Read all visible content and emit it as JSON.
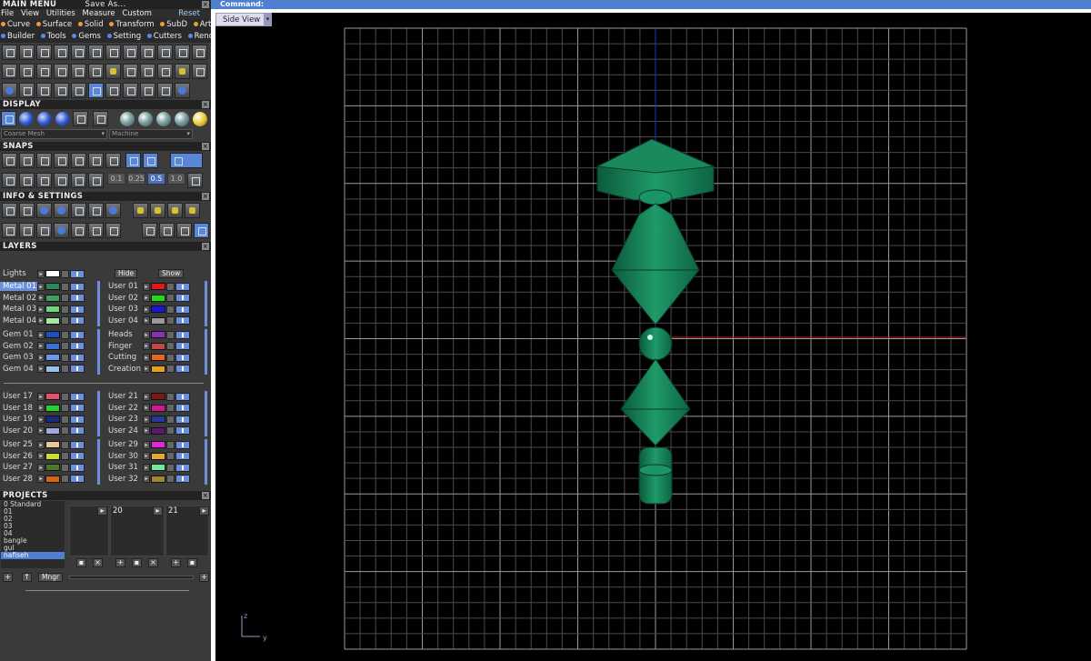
{
  "menu": {
    "title": "MAIN MENU",
    "save_as": "Save As...",
    "items": [
      "File",
      "View",
      "Utilities",
      "Measure",
      "Custom"
    ],
    "reset": "Reset",
    "row1": [
      "Curve",
      "Surface",
      "Solid",
      "Transform",
      "SubD",
      "Art"
    ],
    "row2": [
      "Builder",
      "Tools",
      "Gems",
      "Setting",
      "Cutters",
      "Render"
    ]
  },
  "display": {
    "title": "DISPLAY",
    "mesh_select": "Coarse Mesh",
    "material_select": "Machine"
  },
  "snaps": {
    "title": "SNAPS",
    "values": [
      "0.1",
      "0.25",
      "0.5",
      "1.0"
    ]
  },
  "info": {
    "title": "INFO & SETTINGS"
  },
  "layers": {
    "title": "LAYERS",
    "lights": "Lights",
    "hide": "Hide",
    "show": "Show",
    "groups": [
      {
        "left": [
          {
            "name": "Metal 01",
            "color": "#2a8a55"
          },
          {
            "name": "Metal 02",
            "color": "#3fa060"
          },
          {
            "name": "Metal 03",
            "color": "#6fd878"
          },
          {
            "name": "Metal 04",
            "color": "#a8e8a0"
          }
        ],
        "right": [
          {
            "name": "User 01",
            "color": "#e01818"
          },
          {
            "name": "User 02",
            "color": "#18e018"
          },
          {
            "name": "User 03",
            "color": "#1818d8"
          },
          {
            "name": "User 04",
            "color": "#9a9a9a"
          }
        ]
      },
      {
        "left": [
          {
            "name": "Gem 01",
            "color": "#1a50c0"
          },
          {
            "name": "Gem 02",
            "color": "#3a70d8"
          },
          {
            "name": "Gem 03",
            "color": "#6a98e8"
          },
          {
            "name": "Gem 04",
            "color": "#98c0f0"
          }
        ],
        "right": [
          {
            "name": "Heads",
            "color": "#8a30b8"
          },
          {
            "name": "Finger",
            "color": "#c04848"
          },
          {
            "name": "Cutting",
            "color": "#e06820"
          },
          {
            "name": "Creation",
            "color": "#e8a020"
          }
        ]
      },
      {
        "left": [
          {
            "name": "User 17",
            "color": "#e85070"
          },
          {
            "name": "User 18",
            "color": "#28d028"
          },
          {
            "name": "User 19",
            "color": "#1a2a80"
          },
          {
            "name": "User 20",
            "color": "#a0a8e0"
          }
        ],
        "right": [
          {
            "name": "User 21",
            "color": "#7a1818"
          },
          {
            "name": "User 22",
            "color": "#d01890"
          },
          {
            "name": "User 23",
            "color": "#283898"
          },
          {
            "name": "User 24",
            "color": "#5a1870"
          }
        ]
      },
      {
        "left": [
          {
            "name": "User 25",
            "color": "#e8c8a0"
          },
          {
            "name": "User 26",
            "color": "#c8e030"
          },
          {
            "name": "User 27",
            "color": "#4a7a28"
          },
          {
            "name": "User 28",
            "color": "#d06818"
          }
        ],
        "right": [
          {
            "name": "User 29",
            "color": "#e028d8"
          },
          {
            "name": "User 30",
            "color": "#e8a830"
          },
          {
            "name": "User 31",
            "color": "#70e8a0"
          },
          {
            "name": "User 32",
            "color": "#a08830"
          }
        ]
      }
    ]
  },
  "projects": {
    "title": "PROJECTS",
    "items": [
      "0 Standard",
      "01",
      "02",
      "03",
      "04",
      "bangle",
      "gul",
      "nafiseh"
    ],
    "selected": "nafiseh",
    "thumb_labels": [
      "20",
      "21"
    ],
    "mngr": "Mngr"
  },
  "command": {
    "label": "Command:"
  },
  "viewport": {
    "view_name": "Side View",
    "axis_z": "z",
    "axis_y": "y"
  }
}
